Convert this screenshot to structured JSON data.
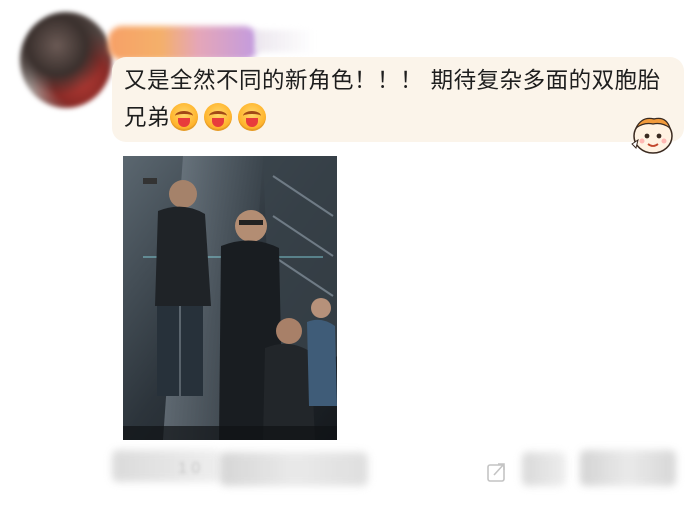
{
  "comment": {
    "text": "又是全然不同的新角色！！！ 期待复杂多面的双胞胎兄弟",
    "emojis": [
      "heart-eyes-emoji",
      "heart-eyes-emoji",
      "heart-eyes-emoji"
    ]
  },
  "photo": {
    "description_icon": "movie-poster-image"
  },
  "footer": {
    "counter_text": "1 0"
  },
  "colors": {
    "bubble": "#fbf4ea",
    "text": "#1e1e1e"
  }
}
